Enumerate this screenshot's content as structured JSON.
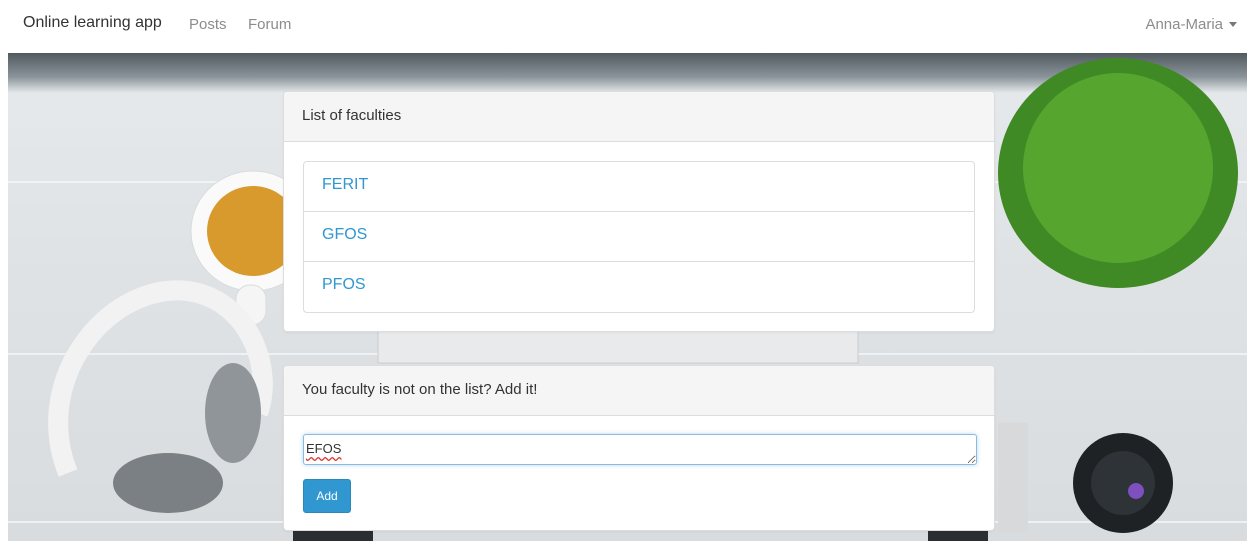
{
  "navbar": {
    "brand": "Online learning app",
    "links": [
      "Posts",
      "Forum"
    ],
    "user": "Anna-Maria"
  },
  "faculties_card": {
    "title": "List of faculties",
    "items": [
      "FERIT",
      "GFOS",
      "PFOS"
    ]
  },
  "add_card": {
    "title": "You faculty is not on the list? Add it!",
    "input_value": "EFOS",
    "button_label": "Add"
  },
  "colors": {
    "link": "#3097d1",
    "button": "#3097d1",
    "muted_nav": "#8c8c8c"
  }
}
